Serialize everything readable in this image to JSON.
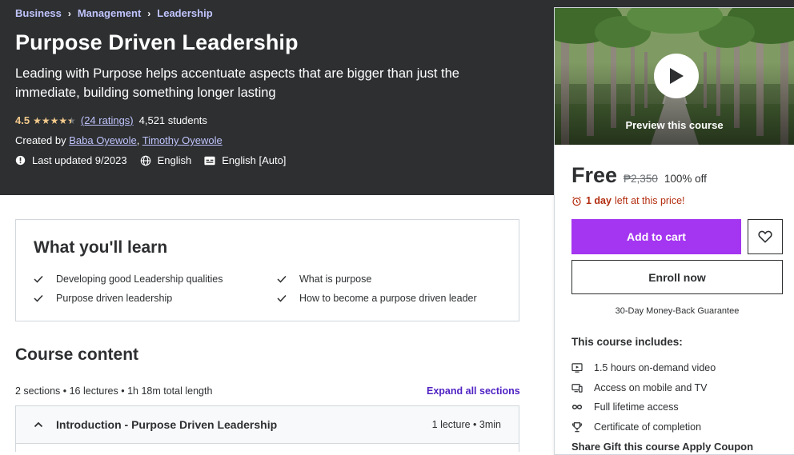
{
  "breadcrumb": [
    "Business",
    "Management",
    "Leadership"
  ],
  "course": {
    "title": "Purpose Driven Leadership",
    "subtitle": "Leading with Purpose helps accentuate aspects that are bigger than just the immediate, building something longer lasting",
    "rating": "4.5",
    "stars": 4.5,
    "ratings_count": "(24 ratings)",
    "students": "4,521 students",
    "created_by_label": "Created by",
    "authors": [
      "Baba Oyewole",
      "Timothy Oyewole"
    ],
    "last_updated": "Last updated 9/2023",
    "language": "English",
    "captions": "English [Auto]"
  },
  "sidebar": {
    "preview_label": "Preview this course",
    "price": "Free",
    "original_price": "₱2,350",
    "discount": "100% off",
    "deadline_bold": "1 day",
    "deadline_rest": "left at this price!",
    "add_to_cart": "Add to cart",
    "enroll_now": "Enroll now",
    "guarantee": "30-Day Money-Back Guarantee",
    "includes_title": "This course includes:",
    "includes": [
      {
        "icon": "video-icon",
        "label": "1.5 hours on-demand video"
      },
      {
        "icon": "mobile-tv-icon",
        "label": "Access on mobile and TV"
      },
      {
        "icon": "infinity-icon",
        "label": "Full lifetime access"
      },
      {
        "icon": "trophy-icon",
        "label": "Certificate of completion"
      }
    ],
    "cut_text": "Share    Gift this course    Apply Coupon"
  },
  "learn": {
    "title": "What you'll learn",
    "items": [
      "Developing good Leadership qualities",
      "What is purpose",
      "Purpose driven leadership",
      "How to become a purpose driven leader"
    ]
  },
  "content": {
    "title": "Course content",
    "summary": "2 sections • 16 lectures • 1h 18m total length",
    "expand_all": "Expand all sections",
    "sections": [
      {
        "title": "Introduction - Purpose Driven Leadership",
        "info": "1 lecture • 3min"
      }
    ]
  },
  "colors": {
    "hero_bg": "#2d2f31",
    "accent_purple": "#a435f0",
    "link_lavender": "#c0c4fc",
    "star_gold": "#f3ca8c",
    "deadline_red": "#b32d0f"
  }
}
